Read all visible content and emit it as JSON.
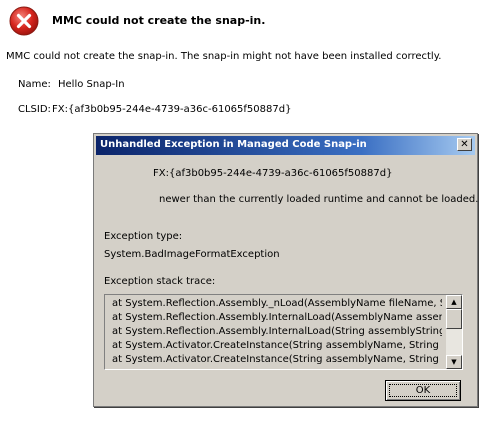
{
  "main": {
    "title": "MMC could not create the snap-in.",
    "message": "MMC could not create the snap-in. The snap-in might not have been installed correctly.",
    "name_label": "Name:",
    "name_value": "Hello Snap-In",
    "clsid_label": "CLSID:",
    "clsid_value": "FX:{af3b0b95-244e-4739-a36c-61065f50887d}",
    "icon": "error-icon"
  },
  "dialog": {
    "title": "Unhandled Exception in Managed Code Snap-in",
    "close_glyph": "✕",
    "clsid": "FX:{af3b0b95-244e-4739-a36c-61065f50887d}",
    "newer_text": "newer than the currently loaded runtime and cannot be loaded.",
    "exception_type_label": "Exception type:",
    "exception_type_value": "System.BadImageFormatException",
    "stack_trace_label": "Exception stack trace:",
    "stack_trace": [
      "at System.Reflection.Assembly._nLoad(AssemblyName fileName, S",
      "at System.Reflection.Assembly.InternalLoad(AssemblyName assem",
      "at System.Reflection.Assembly.InternalLoad(String assemblyString",
      "at System.Activator.CreateInstance(String assemblyName, String t",
      "at System.Activator.CreateInstance(String assemblyName, String t"
    ],
    "scroll_up_glyph": "▲",
    "scroll_down_glyph": "▼",
    "ok_label": "OK"
  },
  "colors": {
    "error_red": "#d6261e",
    "titlebar_dark": "#0b246a",
    "titlebar_light": "#a6caf0",
    "dialog_face": "#d4d0c8"
  }
}
